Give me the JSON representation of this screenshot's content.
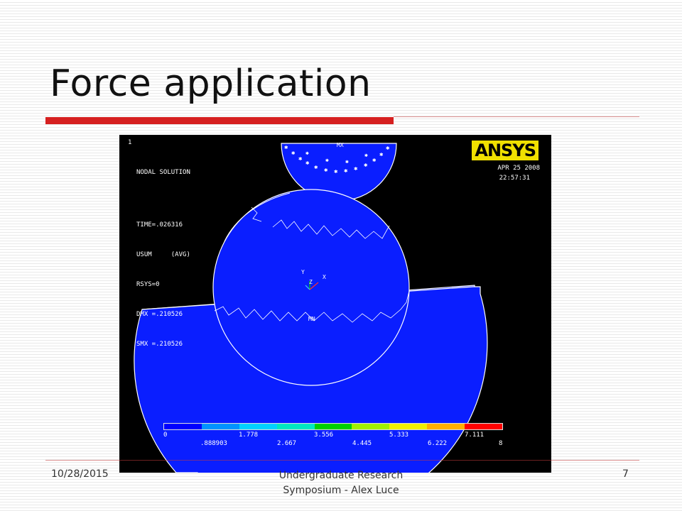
{
  "slide": {
    "title": "Force application",
    "footer": {
      "date": "10/28/2015",
      "center_line1": "Undergraduate Research",
      "center_line2": "Symposium - Alex Luce",
      "page": "7"
    }
  },
  "ansys": {
    "window_number": "1",
    "info_lines": [
      "NODAL SOLUTION",
      "TIME=.026316",
      "USUM     (AVG)",
      "RSYS=0",
      "DMX =.210526",
      "SMX =.210526"
    ],
    "logo": "ANSYS",
    "date": "APR 25 2008",
    "time": "22:57:31",
    "label_mx": "MX",
    "label_mn": "MN",
    "axis_y": "Y",
    "axis_z": "Z",
    "axis_x": "X",
    "legend": {
      "colors": [
        "#0000ff",
        "#0094ff",
        "#00d2ff",
        "#00e8c0",
        "#00d000",
        "#a0f000",
        "#f0f000",
        "#ffb000",
        "#ff0000"
      ],
      "top_labels": [
        "0",
        "1.778",
        "3.556",
        "5.333",
        "7.111"
      ],
      "bottom_labels": [
        ".888903",
        "2.667",
        "4.445",
        "6.222",
        "8"
      ]
    },
    "colors": {
      "background": "#000000",
      "body_blue": "#0a1eff",
      "edge": "#ffffff",
      "logo_yellow": "#f0e000"
    }
  }
}
